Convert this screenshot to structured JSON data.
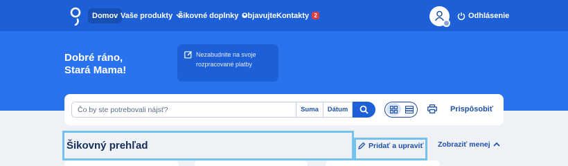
{
  "nav": {
    "home": "Domov",
    "products": "Vaše produkty",
    "addons": "Šikovné doplnky",
    "discover": "Objavujte",
    "contacts": "Kontakty",
    "contacts_badge": "2",
    "logout": "Odhlásenie"
  },
  "hero": {
    "greeting_line1": "Dobré ráno,",
    "greeting_line2": "Stará Mama!",
    "notice": "Nezabudnite na svoje rozpracované platby"
  },
  "search": {
    "placeholder": "Čo by ste potrebovali nájsť?",
    "filter_amount": "Suma",
    "filter_date": "Dátum",
    "customize": "Prispôsobiť"
  },
  "overview": {
    "title": "Šikovný prehľad",
    "edit": "Pridať a upraviť",
    "show_less": "Zobraziť menej"
  },
  "colors": {
    "topbar": "#1d5fd6",
    "hero": "#2a72ee",
    "accent": "#1d4fa8",
    "highlight": "#74c3ee",
    "badge": "#e23b3b"
  }
}
